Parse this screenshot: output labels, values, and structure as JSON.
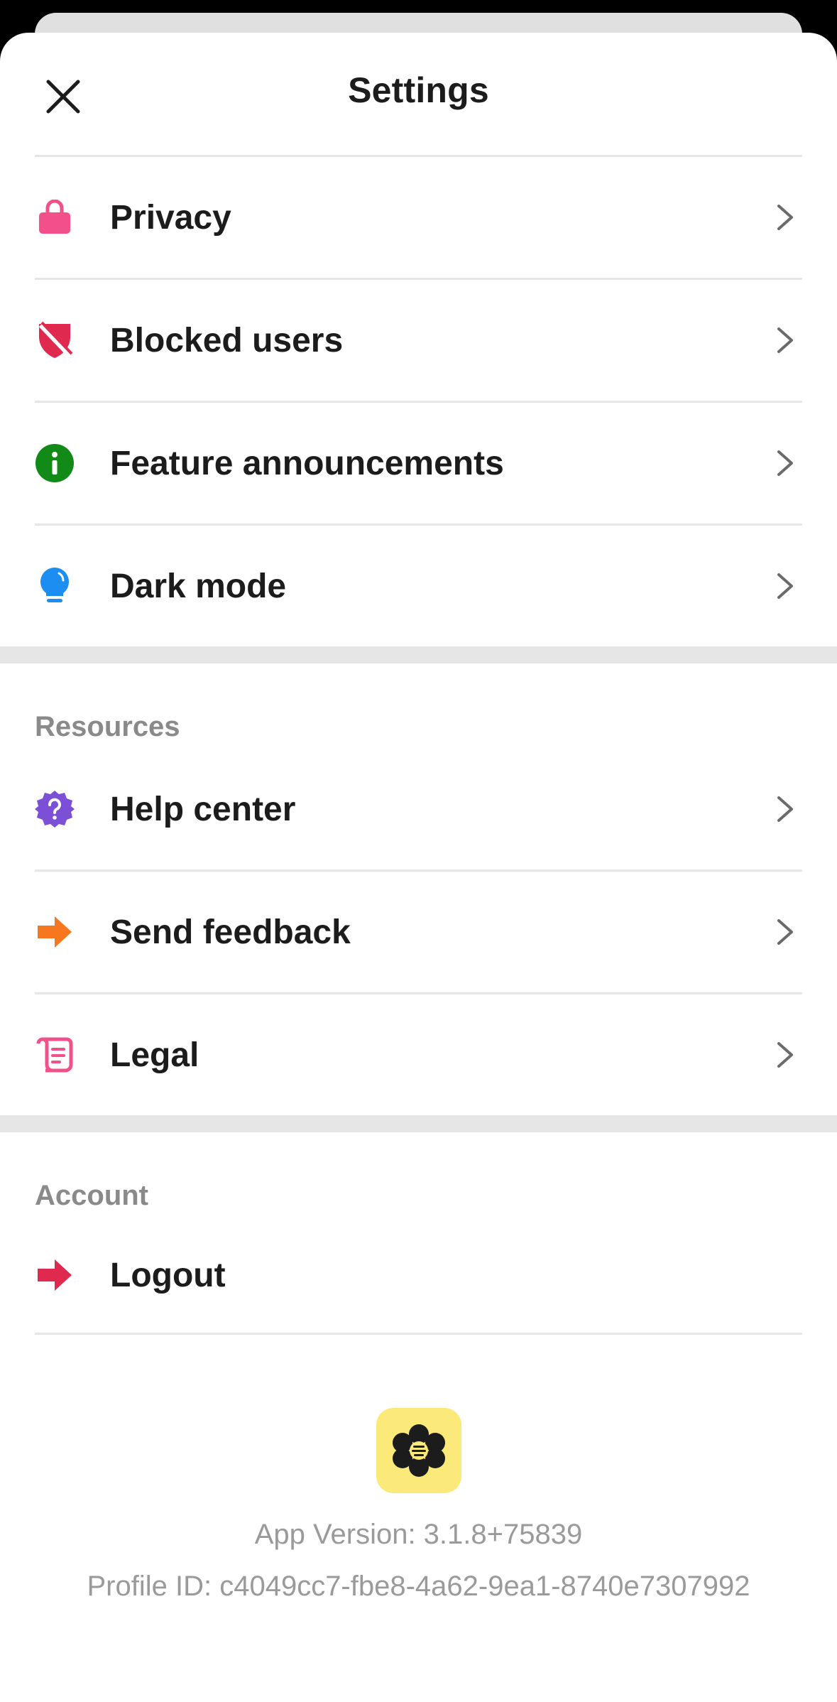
{
  "header": {
    "title": "Settings"
  },
  "icons": {
    "close": "close-icon",
    "chevron": "chevron-right-icon"
  },
  "main_items": [
    {
      "label": "Privacy",
      "icon": "lock-icon",
      "color": "#f2508a"
    },
    {
      "label": "Blocked users",
      "icon": "shield-blocked-icon",
      "color": "#e0294f"
    },
    {
      "label": "Feature announcements",
      "icon": "info-icon",
      "color": "#128a17"
    },
    {
      "label": "Dark mode",
      "icon": "lightbulb-icon",
      "color": "#1c8ef2"
    }
  ],
  "resources": {
    "title": "Resources",
    "items": [
      {
        "label": "Help center",
        "icon": "help-badge-icon",
        "color": "#7b4fd6"
      },
      {
        "label": "Send feedback",
        "icon": "arrow-right-icon",
        "color": "#f7771e"
      },
      {
        "label": "Legal",
        "icon": "scroll-icon",
        "color": "#f2508a"
      }
    ]
  },
  "account": {
    "title": "Account",
    "items": [
      {
        "label": "Logout",
        "icon": "logout-arrow-icon",
        "color": "#e0294f"
      }
    ]
  },
  "footer": {
    "logo": "app-logo-icon",
    "logo_bg": "#fbe97a",
    "version": "App Version: 3.1.8+75839",
    "profile_id": "Profile ID: c4049cc7-fbe8-4a62-9ea1-8740e7307992"
  }
}
